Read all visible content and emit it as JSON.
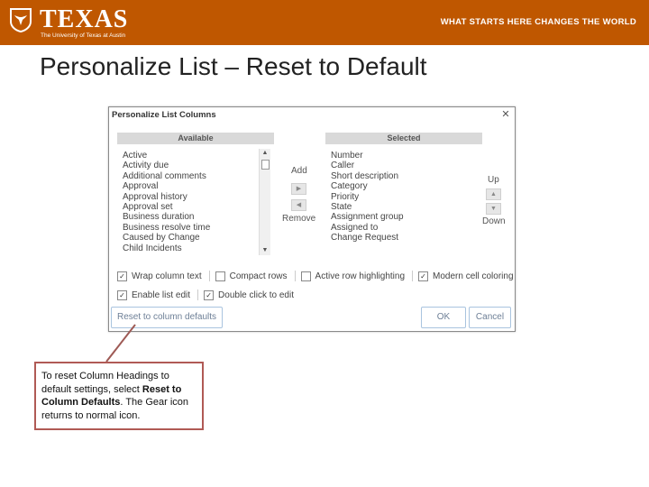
{
  "banner": {
    "logo_word": "TEXAS",
    "logo_subtitle": "The University of Texas at Austin",
    "tagline": "WHAT STARTS HERE CHANGES THE WORLD",
    "color": "#bf5700"
  },
  "slide_title": "Personalize List – Reset to Default",
  "dialog": {
    "title": "Personalize List Columns",
    "close_icon": "close-icon",
    "available": {
      "header": "Available",
      "items": [
        "Active",
        "Activity due",
        "Additional comments",
        "Approval",
        "Approval history",
        "Approval set",
        "Business duration",
        "Business resolve time",
        "Caused by Change",
        "Child Incidents"
      ]
    },
    "selected": {
      "header": "Selected",
      "items": [
        "Number",
        "Caller",
        "Short description",
        "Category",
        "Priority",
        "State",
        "Assignment group",
        "Assigned to",
        "Change Request"
      ]
    },
    "add_label": "Add",
    "remove_label": "Remove",
    "up_label": "Up",
    "down_label": "Down",
    "options": {
      "wrap_column_text": {
        "label": "Wrap column text",
        "checked": true
      },
      "compact_rows": {
        "label": "Compact rows",
        "checked": false
      },
      "active_row_highlighting": {
        "label": "Active row highlighting",
        "checked": false
      },
      "modern_cell_coloring": {
        "label": "Modern cell coloring",
        "checked": true
      },
      "enable_list_edit": {
        "label": "Enable list edit",
        "checked": true
      },
      "double_click_to_edit": {
        "label": "Double click to edit",
        "checked": true
      }
    },
    "reset_button": "Reset to column defaults",
    "ok_button": "OK",
    "cancel_button": "Cancel"
  },
  "callout": {
    "text_before": "To reset Column Headings to default settings, select ",
    "bold": "Reset to Column Defaults",
    "text_after": ".  The Gear icon returns to normal icon.",
    "border_color": "#b05a55"
  }
}
